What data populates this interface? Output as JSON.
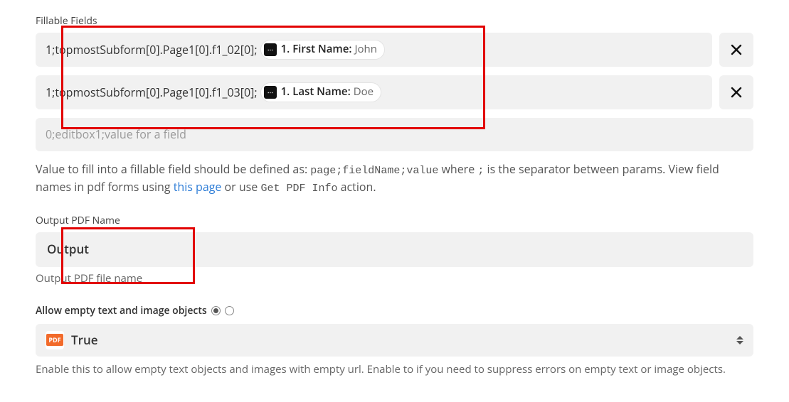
{
  "fillable": {
    "label": "Fillable Fields",
    "rows": [
      {
        "prefix": "1;topmostSubform[0].Page1[0].f1_02[0];",
        "chip_label": "1. First Name:",
        "chip_value": "John"
      },
      {
        "prefix": "1;topmostSubform[0].Page1[0].f1_03[0];",
        "chip_label": "1. Last Name:",
        "chip_value": "Doe"
      }
    ],
    "placeholder": "0;editbox1;value for a field",
    "help_pre": "Value to fill into a fillable field should be defined as: ",
    "help_code1": "page;fieldName;value",
    "help_mid": " where ",
    "help_sep": ";",
    "help_post": " is the separator between params. View field names in pdf forms using ",
    "help_link": "this page",
    "help_or": " or use ",
    "help_code2": "Get PDF Info",
    "help_end": " action."
  },
  "output_name": {
    "label": "Output PDF Name",
    "value": "Output",
    "sub": "Output PDF file name"
  },
  "allow_empty": {
    "label": "Allow empty text and image objects",
    "value": "True",
    "sub": "Enable this to allow empty text objects and images with empty url. Enable to if you need to suppress errors on empty text or image objects."
  },
  "icons": {
    "pdf": "PDF"
  }
}
